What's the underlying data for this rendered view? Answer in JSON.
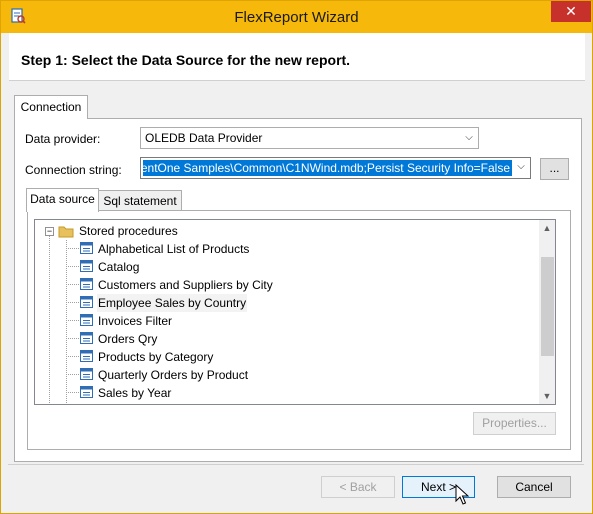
{
  "window": {
    "title": "FlexReport Wizard",
    "close_glyph": "✕"
  },
  "header": {
    "step_title": "Step 1: Select the Data Source for the new report."
  },
  "outer_tabs": [
    {
      "label": "Connection",
      "selected": true
    }
  ],
  "connection": {
    "data_provider_label": "Data provider:",
    "data_provider_value": "OLEDB Data Provider",
    "connection_string_label": "Connection string:",
    "connection_string_value": "entOne Samples\\Common\\C1NWind.mdb;Persist Security Info=False",
    "browse_label": "..."
  },
  "inner_tabs": [
    {
      "label": "Data source",
      "selected": true
    },
    {
      "label": "Sql statement",
      "selected": false
    }
  ],
  "tree": {
    "root": {
      "label": "Stored procedures",
      "expanded": true,
      "icon": "folder-icon",
      "toggle": "−"
    },
    "items": [
      {
        "label": "Alphabetical List of Products",
        "icon": "table-icon"
      },
      {
        "label": "Catalog",
        "icon": "table-icon"
      },
      {
        "label": "Customers and Suppliers by City",
        "icon": "table-icon"
      },
      {
        "label": "Employee Sales by Country",
        "icon": "table-icon"
      },
      {
        "label": "Invoices Filter",
        "icon": "table-icon"
      },
      {
        "label": "Orders Qry",
        "icon": "table-icon"
      },
      {
        "label": "Products by Category",
        "icon": "table-icon"
      },
      {
        "label": "Quarterly Orders by Product",
        "icon": "table-icon"
      },
      {
        "label": "Sales by Year",
        "icon": "table-icon"
      }
    ]
  },
  "buttons": {
    "properties": "Properties...",
    "back": "< Back",
    "next": "Next >",
    "cancel": "Cancel"
  },
  "colors": {
    "titlebar": "#f6b90b",
    "close": "#c7312b",
    "selection": "#0078d7"
  }
}
